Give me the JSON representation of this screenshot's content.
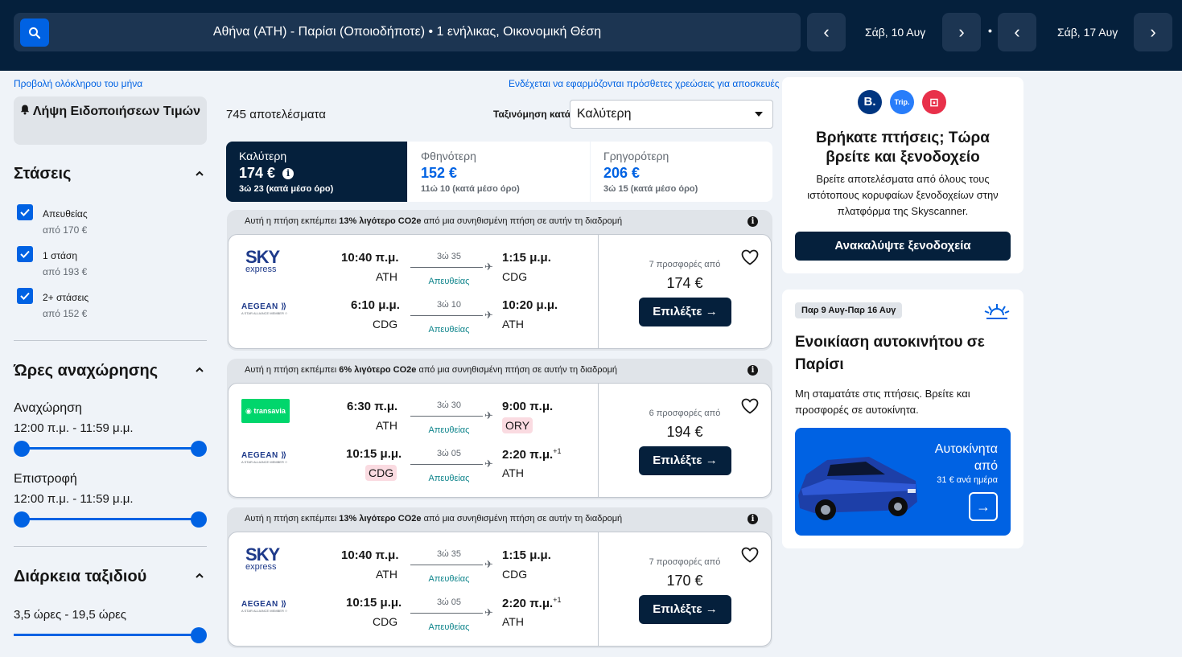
{
  "header": {
    "search_summary": "Αθήνα (ATH) - Παρίσι (Οποιοδήποτε)  •  1 ενήλικας, Οικονομική Θέση",
    "depart_date": "Σάβ, 10 Αυγ",
    "return_date": "Σάβ, 17 Αυγ",
    "separator": "•"
  },
  "links": {
    "whole_month": "Προβολή ολόκληρου του μήνα",
    "baggage_fees": "Ενδέχεται να εφαρμόζονται πρόσθετες χρεώσεις για αποσκευές"
  },
  "sidebar": {
    "price_alert": "Λήψη Ειδοποιήσεων Τιμών",
    "stops_title": "Στάσεις",
    "stops": [
      {
        "label": "Απευθείας",
        "from": "από 170 €",
        "checked": true
      },
      {
        "label": "1 στάση",
        "from": "από 193 €",
        "checked": true
      },
      {
        "label": "2+ στάσεις",
        "from": "από 152 €",
        "checked": true
      }
    ],
    "times_title": "Ώρες αναχώρησης",
    "outbound_label": "Αναχώρηση",
    "outbound_range": "12:00 π.μ. - 11:59 μ.μ.",
    "return_label": "Επιστροφή",
    "return_range": "12:00 π.μ. - 11:59 μ.μ.",
    "duration_title": "Διάρκεια ταξιδιού",
    "duration_range": "3,5 ώρες - 19,5 ώρες"
  },
  "sort": {
    "results_count": "745 αποτελέσματα",
    "label": "Ταξινόμηση κατά",
    "selected": "Καλύτερη"
  },
  "tabs": [
    {
      "title": "Καλύτερη",
      "price": "174 €",
      "sub": "3ώ 23 (κατά μέσο όρο)"
    },
    {
      "title": "Φθηνότερη",
      "price": "152 €",
      "sub": "11ώ 10 (κατά μέσο όρο)"
    },
    {
      "title": "Γρηγορότερη",
      "price": "206 €",
      "sub": "3ώ 15 (κατά μέσο όρο)"
    }
  ],
  "results": [
    {
      "co2_pre": "Αυτή η πτήση εκπέμπει ",
      "co2_bold": "13% λιγότερο CO2e",
      "co2_post": " από μια συνηθισμένη πτήση σε αυτήν τη διαδρομή",
      "out": {
        "airline": "SKY express",
        "dep": "10:40 π.μ.",
        "from": "ATH",
        "dur": "3ώ 35",
        "stops": "Απευθείας",
        "arr": "1:15 μ.μ.",
        "to": "CDG"
      },
      "ret": {
        "airline": "AEGEAN",
        "dep": "6:10 μ.μ.",
        "from": "CDG",
        "dur": "3ώ 10",
        "stops": "Απευθείας",
        "arr": "10:20 μ.μ.",
        "to": "ATH"
      },
      "deals": "7 προσφορές από",
      "price": "174 €",
      "cta": "Επιλέξτε"
    },
    {
      "co2_pre": "Αυτή η πτήση εκπέμπει ",
      "co2_bold": "6% λιγότερο CO2e",
      "co2_post": " από μια συνηθισμένη πτήση σε αυτήν τη διαδρομή",
      "out": {
        "airline": "transavia",
        "dep": "6:30 π.μ.",
        "from": "ATH",
        "dur": "3ώ 30",
        "stops": "Απευθείας",
        "arr": "9:00 π.μ.",
        "to": "ORY"
      },
      "ret": {
        "airline": "AEGEAN",
        "dep": "10:15 μ.μ.",
        "from": "CDG",
        "dur": "3ώ 05",
        "stops": "Απευθείας",
        "arr": "2:20 π.μ.",
        "arr_sup": "+1",
        "to": "ATH"
      },
      "deals": "6 προσφορές από",
      "price": "194 €",
      "cta": "Επιλέξτε"
    },
    {
      "co2_pre": "Αυτή η πτήση εκπέμπει ",
      "co2_bold": "13% λιγότερο CO2e",
      "co2_post": " από μια συνηθισμένη πτήση σε αυτήν τη διαδρομή",
      "out": {
        "airline": "SKY express",
        "dep": "10:40 π.μ.",
        "from": "ATH",
        "dur": "3ώ 35",
        "stops": "Απευθείας",
        "arr": "1:15 μ.μ.",
        "to": "CDG"
      },
      "ret": {
        "airline": "AEGEAN",
        "dep": "10:15 μ.μ.",
        "from": "CDG",
        "dur": "3ώ 05",
        "stops": "Απευθείας",
        "arr": "2:20 π.μ.",
        "arr_sup": "+1",
        "to": "ATH"
      },
      "deals": "7 προσφορές από",
      "price": "170 €",
      "cta": "Επιλέξτε"
    }
  ],
  "hotel_ad": {
    "logos": [
      "B.",
      "Trip.",
      "⊡"
    ],
    "title": "Βρήκατε πτήσεις; Τώρα βρείτε και ξενοδοχείο",
    "text": "Βρείτε αποτελέσματα από όλους τους ιστότοπους κορυφαίων ξενοδοχείων στην πλατφόρμα της Skyscanner.",
    "cta": "Ανακαλύψτε ξενοδοχεία"
  },
  "car_ad": {
    "dates": "Παρ 9 Αυγ-Παρ 16 Αυγ",
    "title": "Ενοικίαση αυτοκινήτου σε Παρίσι",
    "text": "Μη σταματάτε στις πτήσεις. Βρείτε και προσφορές σε αυτοκίνητα.",
    "promo_line1": "Αυτοκίνητα",
    "promo_line2": "από",
    "promo_price": "31 € ανά ημέρα"
  },
  "colors": {
    "navy": "#05203c",
    "blue": "#0062e3",
    "teal": "#0c838a"
  }
}
